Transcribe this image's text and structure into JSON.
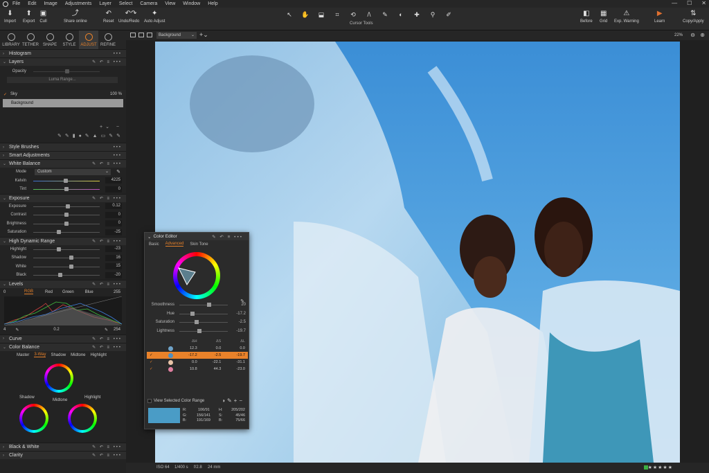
{
  "menu": [
    "File",
    "Edit",
    "Image",
    "Adjustments",
    "Layer",
    "Select",
    "Camera",
    "View",
    "Window",
    "Help"
  ],
  "window_controls": [
    "—",
    "☐",
    "✕"
  ],
  "toolbar_left": [
    {
      "label": "Import",
      "icon": "import-icon"
    },
    {
      "label": "Export",
      "icon": "export-icon"
    },
    {
      "label": "Cull",
      "icon": "cull-icon"
    },
    {
      "label": "Share online",
      "icon": "share-icon"
    },
    {
      "label": "Reset",
      "icon": "reset-icon"
    },
    {
      "label": "Undo/Redo",
      "icon": "undo-icon"
    },
    {
      "label": "Auto Adjust",
      "icon": "wand-icon"
    }
  ],
  "cursor_tools_label": "Cursor Tools",
  "toolbar_right": [
    {
      "label": "Before"
    },
    {
      "label": "Grid"
    },
    {
      "label": "Exp. Warning"
    },
    {
      "label": "Learn"
    },
    {
      "label": "Copy/Apply"
    }
  ],
  "tool_tabs": [
    "LIBRARY",
    "TETHER",
    "SHAPE",
    "STYLE",
    "ADJUST",
    "REFINE"
  ],
  "active_tab": "ADJUST",
  "sections": {
    "histogram": "Histogram",
    "layers": "Layers",
    "opacity": "Opacity",
    "luma_range": "Luma Range...",
    "sky_layer": "Sky",
    "sky_opacity": "100 %",
    "background_layer": "Background",
    "style_brushes": "Style Brushes",
    "smart_adjustments": "Smart Adjustments",
    "white_balance": "White Balance",
    "exposure": "Exposure",
    "hdr": "High Dynamic Range",
    "levels": "Levels",
    "curve": "Curve",
    "color_balance": "Color Balance",
    "black_white": "Black & White",
    "clarity": "Clarity"
  },
  "white_balance": {
    "mode_label": "Mode",
    "mode_value": "Custom",
    "rows": [
      {
        "label": "Kelvin",
        "value": "4225",
        "pos": 0.46
      },
      {
        "label": "Tint",
        "value": "0",
        "pos": 0.5
      }
    ]
  },
  "exposure": [
    {
      "label": "Exposure",
      "value": "0.12",
      "pos": 0.52
    },
    {
      "label": "Contrast",
      "value": "0",
      "pos": 0.5
    },
    {
      "label": "Brightness",
      "value": "0",
      "pos": 0.5
    },
    {
      "label": "Saturation",
      "value": "-25",
      "pos": 0.38
    }
  ],
  "hdr": [
    {
      "label": "Highlight",
      "value": "-23",
      "pos": 0.38
    },
    {
      "label": "Shadow",
      "value": "16",
      "pos": 0.58
    },
    {
      "label": "White",
      "value": "15",
      "pos": 0.58
    },
    {
      "label": "Black",
      "value": "-20",
      "pos": 0.4
    }
  ],
  "levels": {
    "left_value": "0",
    "channels": [
      "RGB",
      "Red",
      "Green",
      "Blue"
    ],
    "active_channel": "RGB",
    "right_value": "255",
    "out_low": "4",
    "mid": "0.2",
    "out_high": "254"
  },
  "color_balance": {
    "modes": [
      "Master",
      "3-Way",
      "Shadow",
      "Midtone",
      "Highlight"
    ],
    "active_mode": "3-Way",
    "wheels": [
      "Midtone",
      "Shadow",
      "Highlight"
    ]
  },
  "viewer": {
    "variant": "Background",
    "zoom": "22%"
  },
  "status": {
    "iso": "ISO 64",
    "shutter": "1/400 s",
    "aperture": "f/2.8",
    "focal": "24 mm",
    "rating_stars": "★★★★★"
  },
  "color_editor": {
    "title": "Color Editor",
    "tabs": [
      "Basic",
      "Advanced",
      "Skin Tone"
    ],
    "active_tab": "Advanced",
    "sliders": [
      {
        "label": "Smoothness",
        "value": "20",
        "pos": 0.62
      },
      {
        "label": "Hue",
        "value": "-17.2",
        "pos": 0.25
      },
      {
        "label": "Saturation",
        "value": "-2.5",
        "pos": 0.35
      },
      {
        "label": "Lightness",
        "value": "-19.7",
        "pos": 0.4
      }
    ],
    "table_headers": [
      "ΔH",
      "ΔS",
      "ΔL"
    ],
    "table_rows": [
      {
        "checked": false,
        "color": "#6fa3c9",
        "dh": "12.3",
        "ds": "0.0",
        "dl": "0.0",
        "selected": false
      },
      {
        "checked": true,
        "color": "#4f8fc0",
        "dh": "-17.2",
        "ds": "-2.5",
        "dl": "-19.7",
        "selected": true
      },
      {
        "checked": true,
        "color": "#e9c4a8",
        "dh": "0.0",
        "ds": "-22.1",
        "dl": "-31.1",
        "selected": false
      },
      {
        "checked": true,
        "color": "#e07fa0",
        "dh": "10.8",
        "ds": "44.3",
        "dl": "-23.0",
        "selected": false
      }
    ],
    "view_selected": "View Selected Color Range",
    "readout": {
      "r_label": "R:",
      "r": "106/91",
      "g_label": "G:",
      "g": "156/141",
      "b_label": "B:",
      "b": "191/169",
      "h_label": "H:",
      "h": "205/202",
      "s_label": "S:",
      "s": "45/46",
      "br_label": "B:",
      "br": "75/66"
    },
    "swatch_color": "#4a9cc6"
  }
}
